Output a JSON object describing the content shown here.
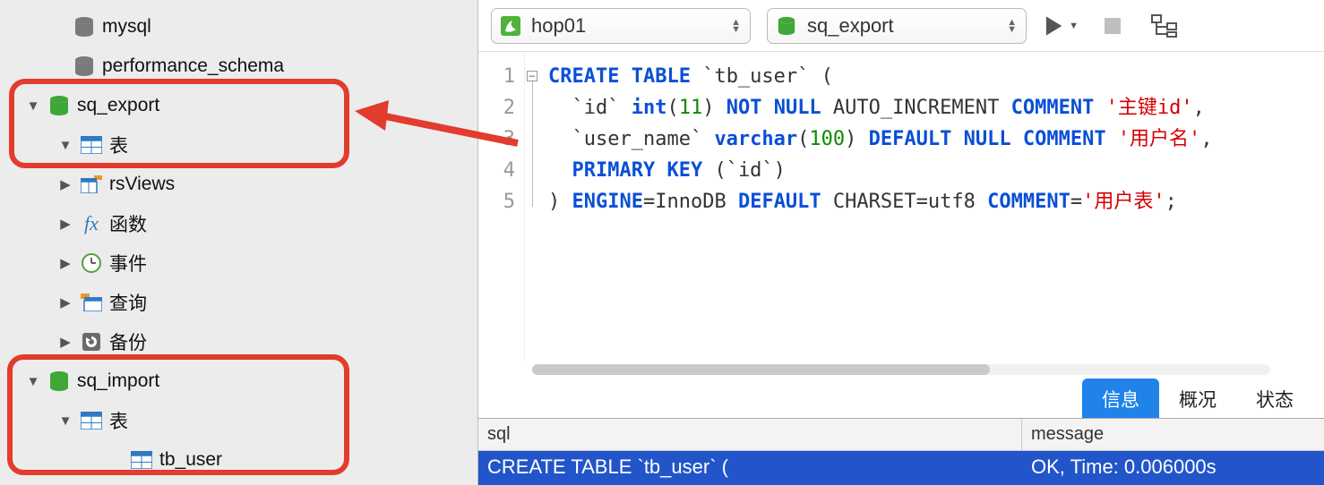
{
  "sidebar": {
    "items": [
      {
        "label": "mysql",
        "arrow": ""
      },
      {
        "label": "performance_schema",
        "arrow": ""
      },
      {
        "label": "sq_export",
        "arrow": "▼"
      },
      {
        "label": "表",
        "arrow": "▼"
      },
      {
        "label": "rsViews",
        "arrow": "▶"
      },
      {
        "label": "函数",
        "arrow": "▶"
      },
      {
        "label": "事件",
        "arrow": "▶"
      },
      {
        "label": "查询",
        "arrow": "▶"
      },
      {
        "label": "备份",
        "arrow": "▶"
      },
      {
        "label": "sq_import",
        "arrow": "▼"
      },
      {
        "label": "表",
        "arrow": "▼"
      },
      {
        "label": "tb_user",
        "arrow": ""
      }
    ]
  },
  "toolbar": {
    "combo1": "hop01",
    "combo2": "sq_export"
  },
  "tabs": {
    "info": "信息",
    "overview": "概况",
    "status": "状态"
  },
  "results": {
    "h1": "sql",
    "h2": "message",
    "r1": "CREATE TABLE `tb_user` (",
    "r2": "OK, Time: 0.006000s"
  },
  "code": {
    "l1a": "CREATE TABLE",
    "l1b": " `tb_user` (",
    "l2a": "  `id` ",
    "l2b": "int",
    "l2c": "(",
    "l2d": "11",
    "l2e": ") ",
    "l2f": "NOT NULL",
    "l2g": " AUTO_INCREMENT ",
    "l2h": "COMMENT",
    "l2i": " ",
    "l2j": "'主键id'",
    "l2k": ",",
    "l3a": "  `user_name` ",
    "l3b": "varchar",
    "l3c": "(",
    "l3d": "100",
    "l3e": ") ",
    "l3f": "DEFAULT NULL COMMENT",
    "l3g": " ",
    "l3h": "'用户名'",
    "l3i": ",",
    "l4a": "  ",
    "l4b": "PRIMARY KEY",
    "l4c": " (`id`)",
    "l5a": ") ",
    "l5b": "ENGINE",
    "l5c": "=InnoDB ",
    "l5d": "DEFAULT",
    "l5e": " CHARSET=utf8 ",
    "l5f": "COMMENT",
    "l5g": "=",
    "l5h": "'用户表'",
    "l5i": ";"
  },
  "gutter": [
    "1",
    "2",
    "3",
    "4",
    "5"
  ]
}
